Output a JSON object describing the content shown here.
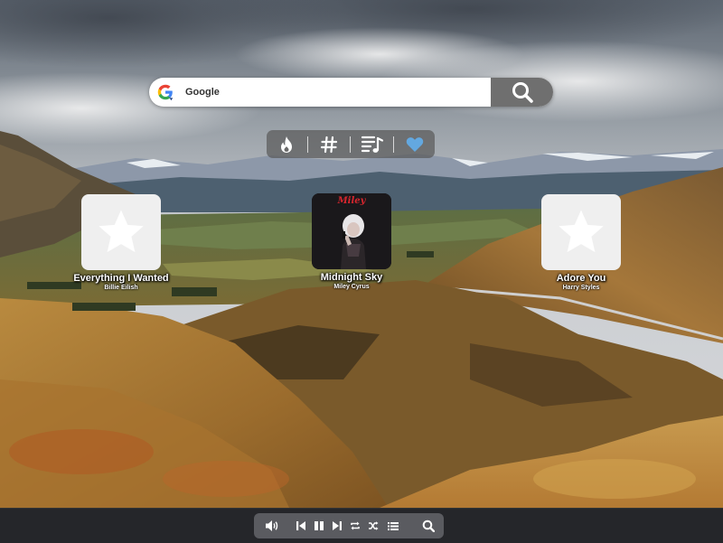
{
  "search": {
    "placeholder": "Google",
    "engine_icon": "google-g-icon",
    "button_icon": "magnifier-icon"
  },
  "categories": [
    {
      "icon": "flame-icon"
    },
    {
      "icon": "hashtag-icon"
    },
    {
      "icon": "playlist-icon"
    },
    {
      "icon": "heart-icon",
      "active": true
    }
  ],
  "tiles": [
    {
      "title": "Everything I Wanted",
      "artist": "Billie Eilish",
      "art_icon": "star-icon"
    },
    {
      "title": "Midnight Sky",
      "artist": "Miley Cyrus",
      "art_icon": "album-cover-image",
      "cover_text": "Miley"
    },
    {
      "title": "Adore You",
      "artist": "Harry Styles",
      "art_icon": "star-icon"
    }
  ],
  "player": {
    "icons": [
      "volume-icon",
      "previous-icon",
      "pause-icon",
      "next-icon",
      "repeat-icon",
      "shuffle-icon",
      "queue-list-icon",
      "search-icon"
    ]
  },
  "colors": {
    "accent_heart": "#63a8e0",
    "player_bar": "#25262a",
    "controls_bg": "#5a5b60",
    "search_button": "#6f6f6f"
  }
}
